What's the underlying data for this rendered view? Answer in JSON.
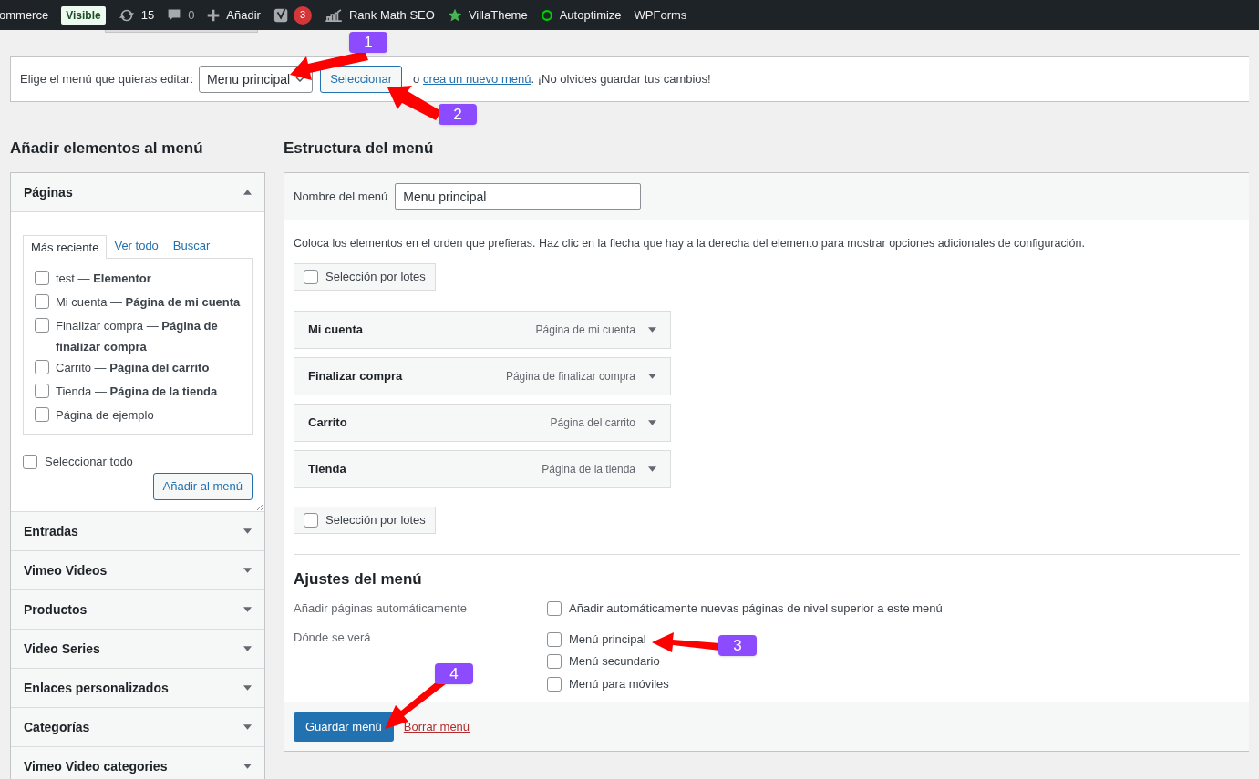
{
  "admin_bar": {
    "items": [
      {
        "kind": "text",
        "label": "ommerce"
      },
      {
        "kind": "badge",
        "label": "Visible"
      },
      {
        "kind": "updates",
        "label": "15"
      },
      {
        "kind": "comments",
        "label": "0"
      },
      {
        "kind": "new",
        "label": "Añadir"
      },
      {
        "kind": "yoast",
        "label": "3"
      },
      {
        "kind": "rankmath",
        "label": "Rank Math SEO"
      },
      {
        "kind": "star",
        "label": "VillaTheme"
      },
      {
        "kind": "ring",
        "label": "Autoptimize"
      },
      {
        "kind": "text",
        "label": "WPForms"
      }
    ]
  },
  "select_menu": {
    "label": "Elige el menú que quieras editar:",
    "value": "Menu principal",
    "button": "Seleccionar",
    "text_before": "o",
    "link": "crea un nuevo menú",
    "text_after": ". ¡No olvides guardar tus cambios!"
  },
  "left": {
    "title": "Añadir elementos al menú",
    "pages": {
      "title": "Páginas",
      "expanded": true,
      "tabs": [
        {
          "label": "Más reciente",
          "selected": true
        },
        {
          "label": "Ver todo",
          "selected": false
        },
        {
          "label": "Buscar",
          "selected": false
        }
      ],
      "items": [
        {
          "label": "test — **Elementor**",
          "checked": false
        },
        {
          "label": "Mi cuenta — **Página de mi cuenta**",
          "checked": false
        },
        {
          "label": "Finalizar compra — **Página de finalizar compra**",
          "checked": false
        },
        {
          "label": "Carrito — **Página del carrito**",
          "checked": false
        },
        {
          "label": "Tienda — **Página de la tienda**",
          "checked": false
        },
        {
          "label": "Página de ejemplo",
          "checked": false
        }
      ],
      "select_all": {
        "label": "Seleccionar todo",
        "checked": false
      },
      "add_button": "Añadir al menú"
    },
    "sections": [
      {
        "title": "Entradas",
        "expanded": false
      },
      {
        "title": "Vimeo Videos",
        "expanded": false
      },
      {
        "title": "Productos",
        "expanded": false
      },
      {
        "title": "Video Series",
        "expanded": false
      },
      {
        "title": "Enlaces personalizados",
        "expanded": false
      },
      {
        "title": "Categorías",
        "expanded": false
      },
      {
        "title": "Vimeo Video categories",
        "expanded": false
      }
    ]
  },
  "right": {
    "title": "Estructura del menú",
    "name_label": "Nombre del menú",
    "name_value": "Menu principal",
    "instructions": "Coloca los elementos en el orden que prefieras. Haz clic en la flecha que hay a la derecha del elemento para mostrar opciones adicionales de configuración.",
    "bulk_top": {
      "label": "Selección por lotes",
      "checked": false
    },
    "menu_items": [
      {
        "title": "Mi cuenta",
        "type": "Página de mi cuenta"
      },
      {
        "title": "Finalizar compra",
        "type": "Página de finalizar compra"
      },
      {
        "title": "Carrito",
        "type": "Página del carrito"
      },
      {
        "title": "Tienda",
        "type": "Página de la tienda"
      }
    ],
    "bulk_bottom": {
      "label": "Selección por lotes",
      "checked": false
    },
    "settings": {
      "title": "Ajustes del menú",
      "auto_label": "Añadir páginas automáticamente",
      "auto_option": {
        "label": "Añadir automáticamente nuevas páginas de nivel superior a este menú",
        "checked": false
      },
      "location_label": "Dónde se verá",
      "locations": [
        {
          "label": "Menú principal",
          "checked": false
        },
        {
          "label": "Menú secundario",
          "checked": false
        },
        {
          "label": "Menú para móviles",
          "checked": false
        }
      ]
    },
    "save_button": "Guardar menú",
    "delete_link": "Borrar menú"
  },
  "annotations": [
    {
      "label": "1"
    },
    {
      "label": "2"
    },
    {
      "label": "3"
    },
    {
      "label": "4"
    }
  ]
}
